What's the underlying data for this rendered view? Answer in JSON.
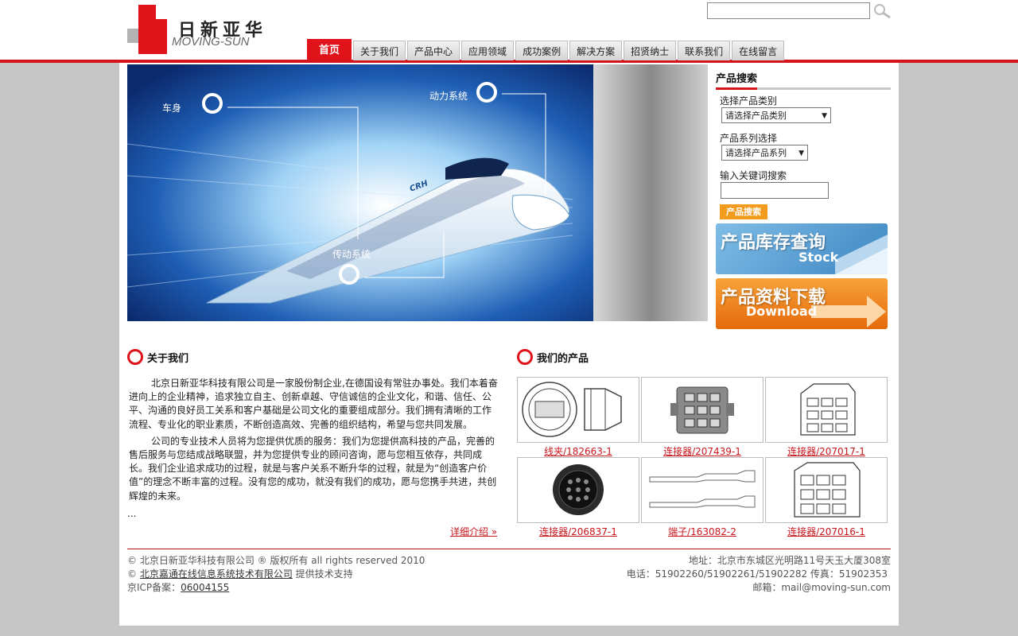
{
  "header": {
    "logo_cn": "日新亚华",
    "logo_en": "MOVING-SUN",
    "search_placeholder": ""
  },
  "nav": [
    {
      "label": "首页",
      "active": true
    },
    {
      "label": "关于我们"
    },
    {
      "label": "产品中心"
    },
    {
      "label": "应用领域"
    },
    {
      "label": "成功案例"
    },
    {
      "label": "解决方案"
    },
    {
      "label": "招贤纳士"
    },
    {
      "label": "联系我们"
    },
    {
      "label": "在线留言"
    }
  ],
  "banner": {
    "label_body": "车身",
    "label_power": "动力系统",
    "label_transmission": "传动系统",
    "train_logo": "CRH"
  },
  "sidebar": {
    "title": "产品搜索",
    "category_label": "选择产品类别",
    "category_value": "请选择产品类别",
    "series_label": "产品系列选择",
    "series_value": "请选择产品系列",
    "keyword_label": "输入关键词搜索",
    "search_button": "产品搜索",
    "stock_zh": "产品库存查询",
    "stock_en": "Stock",
    "download_zh": "产品资料下载",
    "download_en": "Download"
  },
  "about": {
    "title": "关于我们",
    "p1": "北京日新亚华科技有限公司是一家股份制企业,在德国设有常驻办事处。我们本着奋进向上的企业精神，追求独立自主、创新卓越、守信诚信的企业文化，和谐、信任、公平、沟通的良好员工关系和客户基础是公司文化的重要组成部分。我们拥有清晰的工作流程、专业化的职业素质，不断创造高效、完善的组织结构，希望与您共同发展。",
    "p2": "公司的专业技术人员将为您提供优质的服务：我们为您提供高科技的产品，完善的售后服务与您结成战略联盟，并为您提供专业的顾问咨询，愿与您相互依存，共同成长。我们企业追求成功的过程，就是与客户关系不断升华的过程，就是为“创造客户价值”的理念不断丰富的过程。没有您的成功，就没有我们的成功，愿与您携手共进，共创辉煌的未来。",
    "ellipsis": "...",
    "more": "详细介绍 »"
  },
  "products": {
    "title": "我们的产品",
    "items": [
      {
        "caption": "线夹/182663-1",
        "icon": "clamp-drawing"
      },
      {
        "caption": "连接器/207439-1",
        "icon": "connector-grey"
      },
      {
        "caption": "连接器/207017-1",
        "icon": "connector-drawing"
      },
      {
        "caption": "连接器/206837-1",
        "icon": "circular-connector"
      },
      {
        "caption": "端子/163082-2",
        "icon": "terminal-drawing"
      },
      {
        "caption": "连接器/207016-1",
        "icon": "connector-drawing-2"
      }
    ]
  },
  "footer": {
    "copyright": "©  北京日新亚华科技有限公司 ® 版权所有 all rights reserved 2010",
    "support_prefix": "© ",
    "support_company": "北京嘉通在线信息系统技术有限公司",
    "support_suffix": " 提供技术支持",
    "icp_label": "京ICP备案：",
    "icp_number": "06004155",
    "address": "地址：北京市东城区光明路11号天玉大厦308室",
    "phone": "电话：51902260/51902261/51902282 传真：51902353",
    "email": "邮箱：mail@moving-sun.com"
  },
  "colors": {
    "brand_red": "#d6141c",
    "search_orange": "#f29b1d",
    "stock_blue": "#5a9ed0",
    "download_orange": "#f07d12"
  }
}
